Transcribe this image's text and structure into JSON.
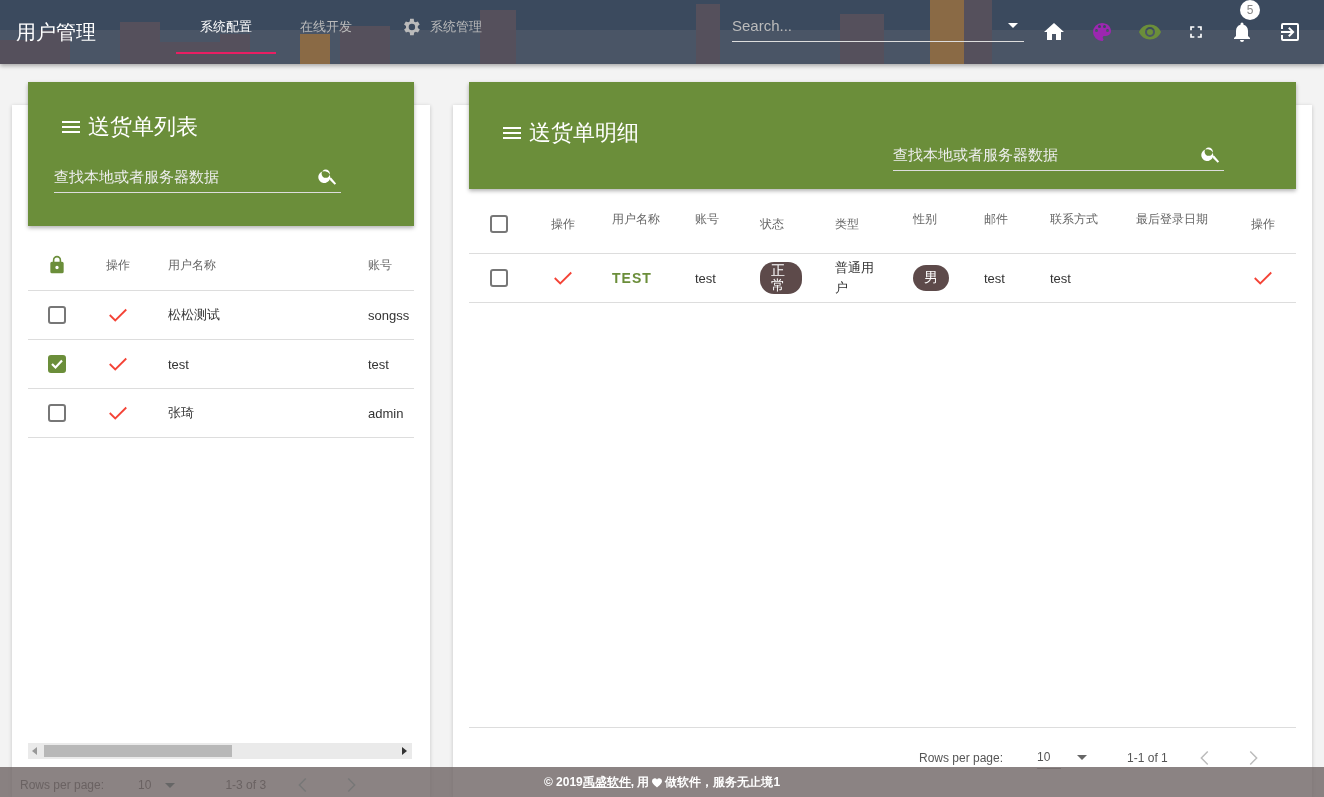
{
  "app_title": "用户管理",
  "tabs": [
    {
      "label": "系统配置",
      "selected": true,
      "kind": "plain"
    },
    {
      "label": "在线开发",
      "selected": false,
      "kind": "plain"
    },
    {
      "label": "系统管理",
      "selected": false,
      "kind": "icon"
    }
  ],
  "search": {
    "placeholder": "Search..."
  },
  "notifications": {
    "badge": "5"
  },
  "list_panel": {
    "title": "送货单列表",
    "search_placeholder": "查找本地或者服务器数据",
    "columns": [
      "操作",
      "用户名称",
      "账号"
    ],
    "rows": [
      {
        "checked": false,
        "name": "松松测试",
        "account": "songss"
      },
      {
        "checked": true,
        "name": "test",
        "account": "test"
      },
      {
        "checked": false,
        "name": "张琦",
        "account": "admin"
      }
    ],
    "pagination": {
      "rows_per_page_label": "Rows per page:",
      "rows_per_page": "10",
      "range": "1-3 of 3"
    }
  },
  "detail_panel": {
    "title": "送货单明细",
    "search_placeholder": "查找本地或者服务器数据",
    "header_checked": false,
    "columns": [
      "操作",
      "用户名称",
      "账号",
      "状态",
      "类型",
      "性别",
      "邮件",
      "联系方式",
      "最后登录日期",
      "操作"
    ],
    "rows": [
      {
        "checked": false,
        "name": "TEST",
        "account": "test",
        "status": "正常",
        "type": "普通用户",
        "gender": "男",
        "email": "test",
        "contact": "test"
      }
    ],
    "pagination": {
      "rows_per_page_label": "Rows per page:",
      "rows_per_page": "10",
      "range": "1-1 of 1"
    }
  },
  "footer": {
    "prefix": "© 2019 ",
    "link": "禹盛软件",
    "middle": ", 用 ",
    "suffix": " 做软件，服务无止境1"
  }
}
